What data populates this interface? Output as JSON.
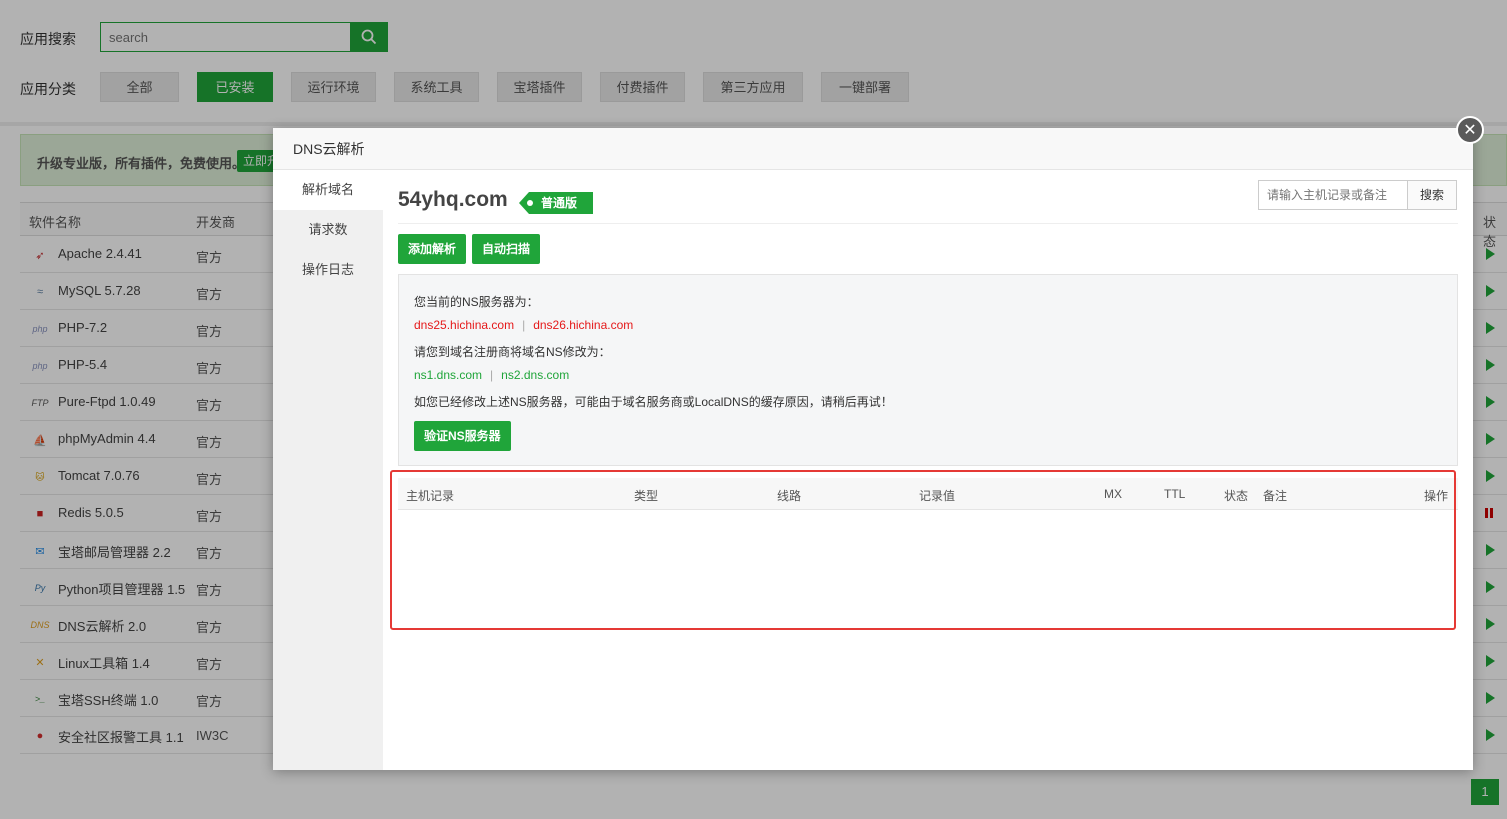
{
  "header": {
    "search_label": "应用搜索",
    "search_placeholder": "search",
    "category_label": "应用分类",
    "categories": [
      {
        "label": "全部"
      },
      {
        "label": "已安装"
      },
      {
        "label": "运行环境"
      },
      {
        "label": "系统工具"
      },
      {
        "label": "宝塔插件"
      },
      {
        "label": "付费插件"
      },
      {
        "label": "第三方应用"
      },
      {
        "label": "一键部署"
      }
    ],
    "active_category": "已安装"
  },
  "promo": {
    "text": "升级专业版，所有插件，免费使用。",
    "button": "立即升"
  },
  "app_table": {
    "columns": {
      "name": "软件名称",
      "vendor": "开发商",
      "status": "状态"
    },
    "rows": [
      {
        "name": "Apache 2.4.41",
        "vendor": "官方",
        "icon": "apache-feather-icon",
        "status": "running"
      },
      {
        "name": "MySQL 5.7.28",
        "vendor": "官方",
        "icon": "mysql-dolphin-icon",
        "status": "running"
      },
      {
        "name": "PHP-7.2",
        "vendor": "官方",
        "icon": "php-icon",
        "status": "running"
      },
      {
        "name": "PHP-5.4",
        "vendor": "官方",
        "icon": "php-icon",
        "status": "running"
      },
      {
        "name": "Pure-Ftpd 1.0.49",
        "vendor": "官方",
        "icon": "ftp-icon",
        "status": "running"
      },
      {
        "name": "phpMyAdmin 4.4",
        "vendor": "官方",
        "icon": "phpmyadmin-sail-icon",
        "status": "running"
      },
      {
        "name": "Tomcat 7.0.76",
        "vendor": "官方",
        "icon": "tomcat-icon",
        "status": "running"
      },
      {
        "name": "Redis 5.0.5",
        "vendor": "官方",
        "icon": "redis-cube-icon",
        "status": "paused"
      },
      {
        "name": "宝塔邮局管理器 2.2",
        "vendor": "官方",
        "icon": "mail-icon",
        "status": "running"
      },
      {
        "name": "Python项目管理器 1.5",
        "vendor": "官方",
        "icon": "python-icon",
        "status": "running"
      },
      {
        "name": "DNS云解析 2.0",
        "vendor": "官方",
        "icon": "dns-icon",
        "status": "running"
      },
      {
        "name": "Linux工具箱 1.4",
        "vendor": "官方",
        "icon": "tools-icon",
        "status": "running"
      },
      {
        "name": "宝塔SSH终端 1.0",
        "vendor": "官方",
        "icon": "terminal-icon",
        "status": "running"
      },
      {
        "name": "安全社区报警工具 1.1",
        "vendor": "IW3C",
        "icon": "alert-icon",
        "status": "running"
      }
    ],
    "page": "1"
  },
  "modal": {
    "title": "DNS云解析",
    "close": "✕",
    "side_menu": [
      {
        "label": "解析域名"
      },
      {
        "label": "请求数"
      },
      {
        "label": "操作日志"
      }
    ],
    "domain": "54yhq.com",
    "plan": "普通版",
    "search_placeholder": "请输入主机记录或备注",
    "search_button": "搜索",
    "add_button": "添加解析",
    "scan_button": "自动扫描",
    "ns_info": {
      "current_label": "您当前的NS服务器为：",
      "current_ns": [
        "dns25.hichina.com",
        "dns26.hichina.com"
      ],
      "change_label": "请您到域名注册商将域名NS修改为：",
      "target_ns": [
        "ns1.dns.com",
        "ns2.dns.com"
      ],
      "note": "如您已经修改上述NS服务器，可能由于域名服务商或LocalDNS的缓存原因，请稍后再试！",
      "verify_button": "验证NS服务器"
    },
    "records_table": {
      "columns": [
        "主机记录",
        "类型",
        "线路",
        "记录值",
        "MX",
        "TTL",
        "状态",
        "备注",
        "操作"
      ],
      "rows": []
    }
  },
  "colors": {
    "accent": "#20a53a",
    "ns_current": "#e5191a",
    "highlight_border": "#e53935"
  }
}
